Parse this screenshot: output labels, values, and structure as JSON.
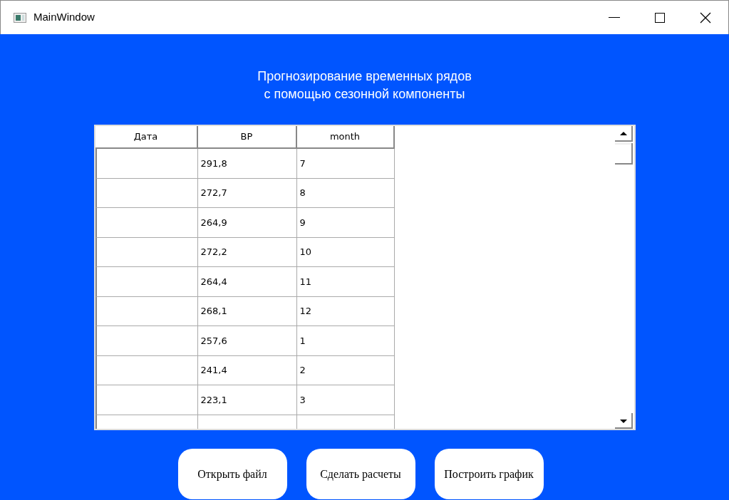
{
  "window": {
    "title": "MainWindow"
  },
  "heading": [
    "Прогнозирование временных рядов",
    "с помощью сезонной компоненты"
  ],
  "table": {
    "columns": [
      "Дата",
      "ВР",
      "month"
    ],
    "rows": [
      {
        "date": "",
        "value": "291,8",
        "month": "7"
      },
      {
        "date": "",
        "value": "272,7",
        "month": "8"
      },
      {
        "date": "",
        "value": "264,9",
        "month": "9"
      },
      {
        "date": "",
        "value": "272,2",
        "month": "10"
      },
      {
        "date": "",
        "value": "264,4",
        "month": "11"
      },
      {
        "date": "",
        "value": "268,1",
        "month": "12"
      },
      {
        "date": "",
        "value": "257,6",
        "month": "1"
      },
      {
        "date": "",
        "value": "241,4",
        "month": "2"
      },
      {
        "date": "",
        "value": "223,1",
        "month": "3"
      }
    ]
  },
  "buttons": [
    "Открыть файл",
    "Сделать расчеты",
    "Построить график"
  ]
}
